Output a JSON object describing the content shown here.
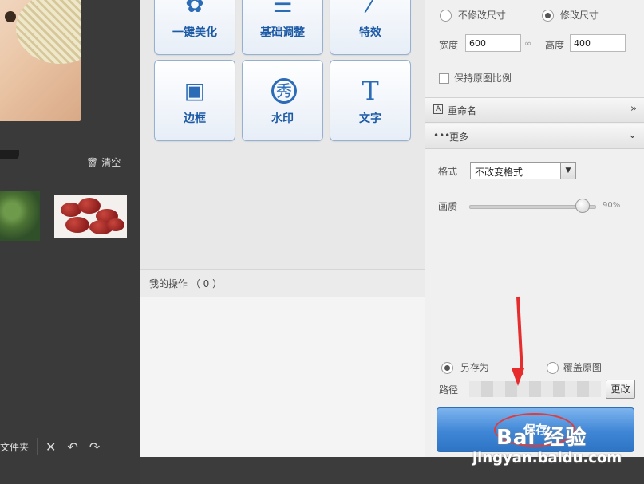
{
  "left_panel": {
    "clear_label": "清空",
    "folder_label": "文件夹",
    "icons": [
      "close-icon",
      "undo-icon",
      "redo-icon"
    ]
  },
  "tools": [
    {
      "label": "一键美化",
      "icon": "flower-icon"
    },
    {
      "label": "基础调整",
      "icon": "sliders-icon"
    },
    {
      "label": "特效",
      "icon": "magic-wand-icon"
    },
    {
      "label": "边框",
      "icon": "frame-icon",
      "glyph": "▣"
    },
    {
      "label": "水印",
      "icon": "watermark-icon",
      "glyph": "秀"
    },
    {
      "label": "文字",
      "icon": "text-icon",
      "glyph": "T"
    }
  ],
  "operations": {
    "title": "我的操作 （ 0 ）"
  },
  "resize": {
    "keep_size_label": "不修改尺寸",
    "change_size_label": "修改尺寸",
    "width_label": "宽度",
    "width_value": "600",
    "height_label": "高度",
    "height_value": "400",
    "keep_ratio_label": "保持原图比例"
  },
  "rename": {
    "title": "重命名",
    "chevron": "»"
  },
  "more": {
    "title": "更多",
    "chevron": "⌄",
    "format_label": "格式",
    "format_value": "不改变格式",
    "quality_label": "画质",
    "quality_value": "90%",
    "quality_fraction": 0.9
  },
  "output": {
    "save_as_label": "另存为",
    "overwrite_label": "覆盖原图",
    "path_label": "路径",
    "change_button": "更改",
    "save_button": "保存"
  },
  "watermark": {
    "text": "jingyan.baidu.com",
    "logo": "Bai 经验"
  },
  "colors": {
    "accent_blue": "#3f86d6",
    "annotation_red": "#e62c2c"
  }
}
